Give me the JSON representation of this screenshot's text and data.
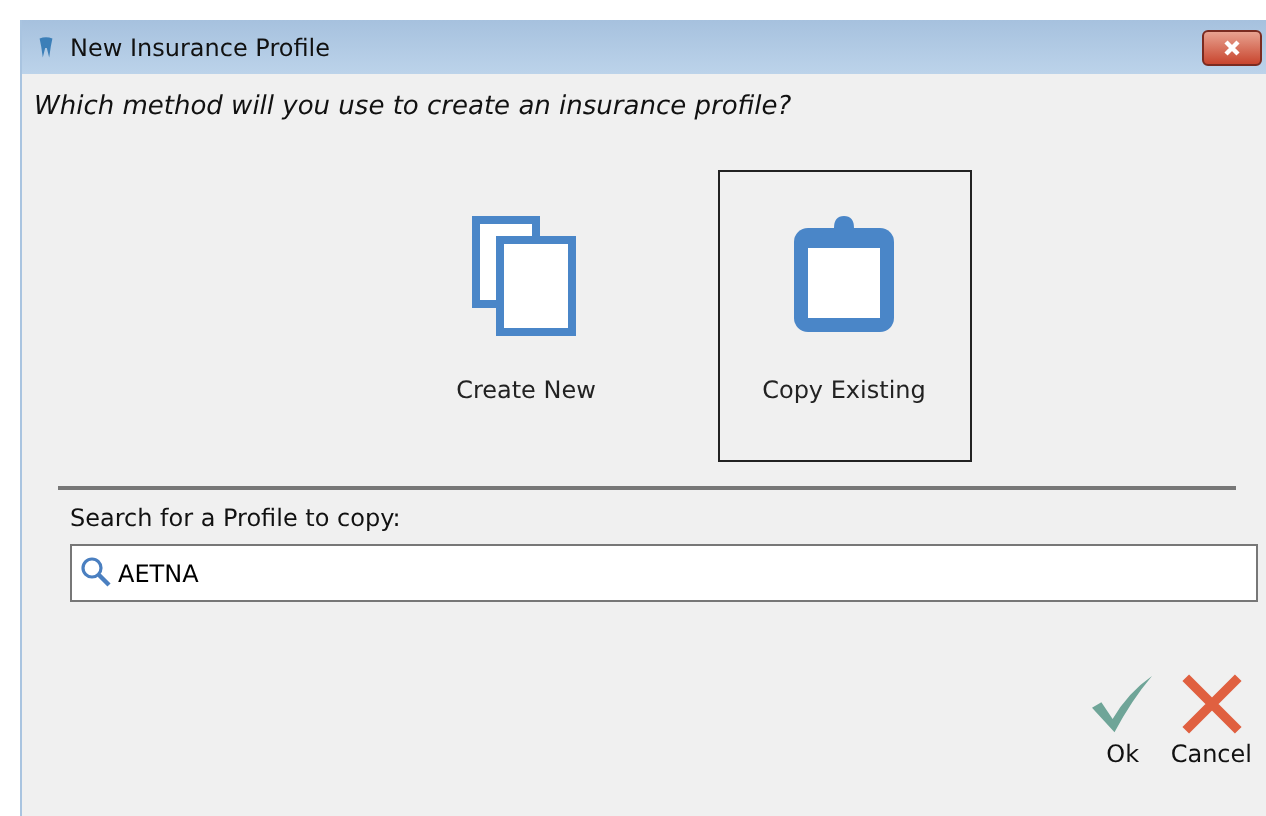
{
  "window": {
    "title": "New Insurance Profile"
  },
  "prompt": "Which method will you use to create an insurance profile?",
  "methods": [
    {
      "kind": "new",
      "label": "Create New",
      "selected": false
    },
    {
      "kind": "copy",
      "label": "Copy Existing",
      "selected": true
    }
  ],
  "search": {
    "label": "Search for a Profile to copy:",
    "value": "AETNA"
  },
  "buttons": [
    {
      "kind": "ok",
      "label": "Ok"
    },
    {
      "kind": "cancel",
      "label": "Cancel"
    }
  ]
}
